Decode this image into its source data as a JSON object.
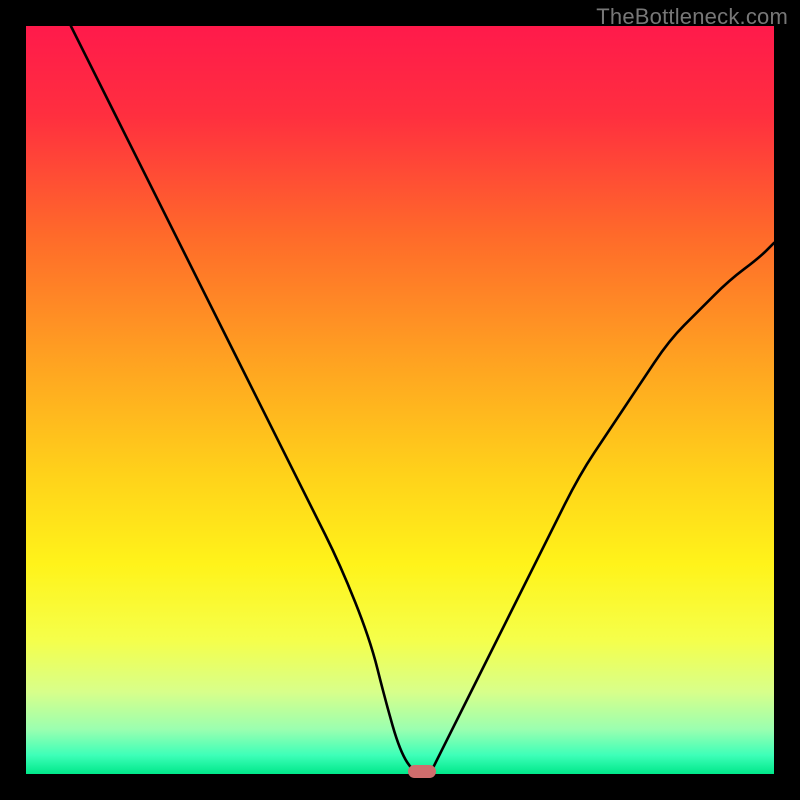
{
  "watermark": "TheBottleneck.com",
  "chart_data": {
    "type": "line",
    "title": "",
    "xlabel": "",
    "ylabel": "",
    "xlim": [
      0,
      100
    ],
    "ylim": [
      0,
      100
    ],
    "grid": false,
    "background": "rainbow-gradient (red top → green bottom)",
    "series": [
      {
        "name": "bottleneck-curve",
        "x": [
          6,
          10,
          14,
          18,
          22,
          26,
          30,
          34,
          38,
          42,
          46,
          48,
          50,
          52,
          54,
          55,
          58,
          62,
          66,
          70,
          74,
          78,
          82,
          86,
          90,
          94,
          98,
          100
        ],
        "y": [
          100,
          92,
          84,
          76,
          68,
          60,
          52,
          44,
          36,
          28,
          18,
          10,
          3,
          0,
          0,
          2,
          8,
          16,
          24,
          32,
          40,
          46,
          52,
          58,
          62,
          66,
          69,
          71
        ]
      }
    ],
    "marker": {
      "x": 53,
      "y": 0,
      "color": "#cf6d6d",
      "shape": "rounded-rect"
    },
    "gradient_stops": [
      {
        "pos": 0.0,
        "color": "#ff1a4b"
      },
      {
        "pos": 0.12,
        "color": "#ff2f3f"
      },
      {
        "pos": 0.28,
        "color": "#ff6a2a"
      },
      {
        "pos": 0.45,
        "color": "#ffa321"
      },
      {
        "pos": 0.6,
        "color": "#ffd21a"
      },
      {
        "pos": 0.72,
        "color": "#fff31a"
      },
      {
        "pos": 0.82,
        "color": "#f5ff4a"
      },
      {
        "pos": 0.89,
        "color": "#d8ff8a"
      },
      {
        "pos": 0.94,
        "color": "#9bffb0"
      },
      {
        "pos": 0.975,
        "color": "#3dffb8"
      },
      {
        "pos": 1.0,
        "color": "#00e88a"
      }
    ]
  }
}
